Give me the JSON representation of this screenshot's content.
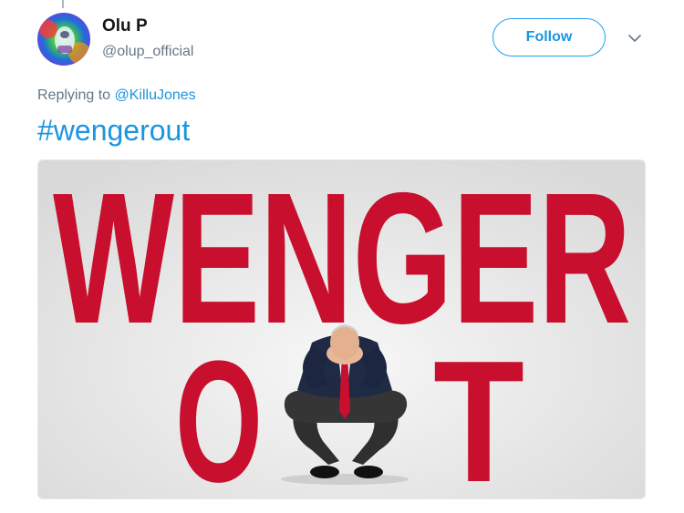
{
  "author": {
    "display_name": "Olu P",
    "handle": "@olup_official"
  },
  "follow_button": {
    "label": "Follow"
  },
  "reply": {
    "prefix": "Replying to",
    "mention": "@KilluJones"
  },
  "tweet": {
    "hashtag": "#wengerout"
  },
  "media": {
    "headline": "WENGER",
    "letter_o": "O",
    "letter_t": "T",
    "text_color": "#c8102e",
    "background_color": "#e6e6e6"
  },
  "colors": {
    "link": "#1b95e0",
    "muted": "#657786",
    "text": "#14171a"
  }
}
